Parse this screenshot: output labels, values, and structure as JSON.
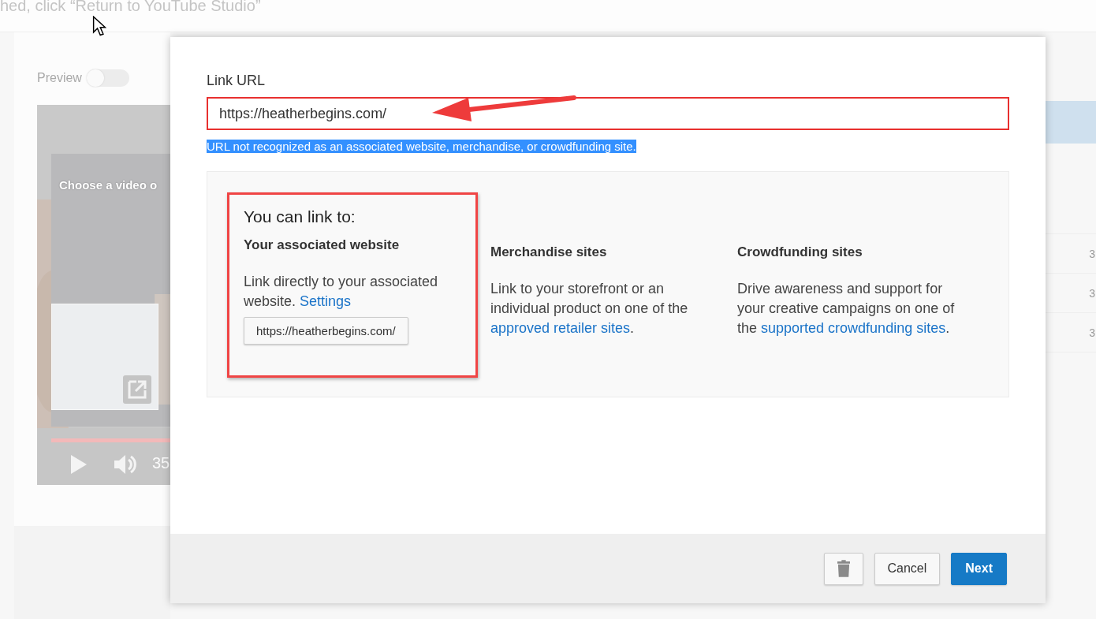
{
  "background": {
    "instruction": "hed, click “Return to YouTube Studio”",
    "preview_label": "Preview",
    "preview_toggle": {
      "on": false
    },
    "video_overlay_text": "Choose a video o",
    "time": "35",
    "row_values": [
      "3",
      "3",
      "3"
    ]
  },
  "dialog": {
    "field_label": "Link URL",
    "url_value": "https://heatherbegins.com/",
    "error": {
      "text": "URL not recognized as an associated website, merchandise, or crowdfunding site.",
      "selected": true
    },
    "heading": "You can link to:",
    "options": [
      {
        "title": "Your associated website",
        "text": "Link directly to your associated website.",
        "link": "Settings",
        "chip": "https://heatherbegins.com/",
        "highlighted": true
      },
      {
        "title": "Merchandise sites",
        "text": "Link to your storefront or an individual product on one of the",
        "link": "approved retailer sites",
        "after": ".",
        "highlighted": false
      },
      {
        "title": "Crowdfunding sites",
        "text": "Drive awareness and support for your creative campaigns on one of the",
        "link": "supported crowdfunding sites",
        "after": ".",
        "highlighted": false
      }
    ],
    "buttons": {
      "cancel": "Cancel",
      "next": "Next"
    }
  }
}
